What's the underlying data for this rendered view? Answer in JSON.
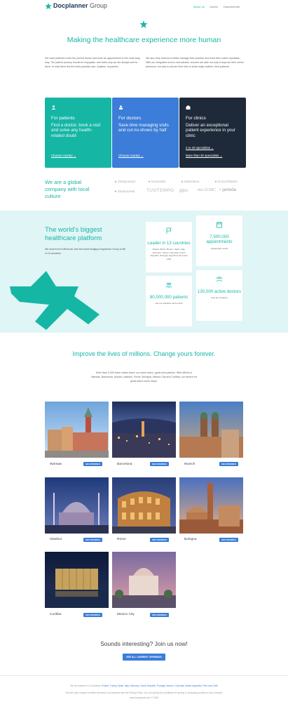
{
  "header": {
    "brand": "Docplanner",
    "brand_suffix": "Group",
    "nav": [
      "About us",
      "Career",
      "Departments"
    ]
  },
  "hero": {
    "title": "Making the healthcare experience more human",
    "intro_left": "We want patients to find the perfect doctor and book an appointment in the most easy way. The patient journey should be enjoyable, and that's why we are always next to them: to help them find the best possible care. Anytime, anywhere.",
    "intro_right": "We also help doctors to better manage their practice and build their online reputation. With our integrated end-to-end solution, doctors are able not only to improve their online presence, but also to devote their time to what really matters: their patients."
  },
  "cards": [
    {
      "title": "For patients",
      "desc": "Find a doctor, book a visit and solve any health-related doubt",
      "link": "Choose country",
      "color": "#16b6a5",
      "icon": "user-icon"
    },
    {
      "title": "For doctors",
      "desc": "Save time managing visits and cut no-shows by half",
      "link": "Choose country",
      "color": "#3b7dd8",
      "icon": "doctor-icon"
    },
    {
      "title": "For clinics",
      "desc": "Deliver an exceptional patient experience in your clinic",
      "link1": "2 to 20 specialists",
      "link2": "More than 20 specialists",
      "color": "#1e2a3a",
      "icon": "clinic-icon"
    }
  ],
  "global": {
    "title": "We are a global company with local culture",
    "logos": [
      "ZnanyLekarz",
      "Doctoralia",
      "MioDottore",
      "DoctorTakvimi",
      "ZnamyLekar",
      "TUOTEMPO",
      "gipo",
      "doc.CLINIC",
      "jameda"
    ]
  },
  "platform": {
    "title": "The world's biggest healthcare platform",
    "desc": "We work from 8 offices all over the world bringing Docplanner Group to life in 13 countries.",
    "stats": [
      {
        "value": "Leader in 13 countries",
        "note": "Poland, Brazil, Mexico, Spain, Italy, Germany, Turkey, Colombia, Czech Republic, Portugal, Argentina, Peru and Chile",
        "icon": "flag-icon"
      },
      {
        "value": "7,500,000 appointments",
        "note": "booked last month",
        "icon": "calendar-icon"
      },
      {
        "value": "80,000,000 patients",
        "note": "visit our websites each month",
        "icon": "patients-icon"
      },
      {
        "value": "130,000 active doctors",
        "note": "trust our solutions",
        "icon": "doctors-icon"
      }
    ]
  },
  "careers": {
    "title": "Improve the lives of millions. Change yours forever.",
    "desc": "More than 2,000 team mates share our same vision, goals and passion. With offices in Warsaw, Barcelona, Munich, Istanbul, Rome, Bologna, Mexico City and Curitiba, our search for great talent never stops.",
    "button": "SEE OPENINGS",
    "cities": [
      "Warsaw",
      "Barcelona",
      "Munich",
      "Istanbul",
      "Rome",
      "Bologna",
      "Curitiba",
      "Mexico City"
    ]
  },
  "join": {
    "title": "Sounds interesting? Join us now!",
    "button": "SEE ALL CURRENT OPENINGS"
  },
  "footer": {
    "prefix": "We are leaders in 13 countries:",
    "countries": "Poland, Turkey, Spain, Italy, Germany, Czech Republic, Portugal, Mexico, Colombia, Brazil, Argentina, Peru and Chile",
    "line2": "This site uses cookies to deliver services in accordance with the Privacy Policy. You can specify the conditions for storing or accessing cookies on your browser.",
    "line3": "www.docplanner.com © 2020"
  }
}
